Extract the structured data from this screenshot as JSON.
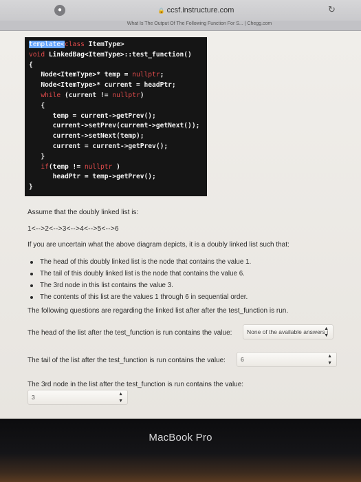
{
  "browser": {
    "url": "ccsf.instructure.com",
    "tab_title": "What Is The Output Of The Following Function For S... | Chegg.com"
  },
  "code_lines": [
    "template<class ItemType>",
    "void LinkedBag<ItemType>::test_function()",
    "{",
    "   Node<ItemType>* temp = nullptr;",
    "   Node<ItemType>* current = headPtr;",
    "   while (current != nullptr)",
    "   {",
    "      temp = current->getPrev();",
    "      current->setPrev(current->getNext());",
    "      current->setNext(temp);",
    "      current = current->getPrev();",
    "   }",
    "   if(temp != nullptr )",
    "      headPtr = temp->getPrev();",
    "}"
  ],
  "question": {
    "assume": "Assume that the doubly linked list is:",
    "list": "1<-->2<-->3<-->4<-->5<-->6",
    "intro": "If you are uncertain what the above diagram depicts, it is a doubly linked list such that:",
    "facts": [
      "The head of this doubly linked list is the node that contains the value 1.",
      "The tail of this doubly linked list is the node that contains the value 6.",
      "The 3rd node in this list contains the value 3.",
      "The contents of this list are the values 1 through 6 in sequential order."
    ],
    "following": "The following questions are regarding the linked list after after the test_function is run.",
    "q1": {
      "label": "The head of the list after the test_function is run contains the value:",
      "value": "None of the available answers i"
    },
    "q2": {
      "label": "The tail of the list after the test_function is run contains the value:",
      "value": "6"
    },
    "q3": {
      "label": "The 3rd node in the list after the test_function is run contains the value:",
      "value": "3"
    }
  },
  "laptop": {
    "brand": "MacBook Pro"
  }
}
